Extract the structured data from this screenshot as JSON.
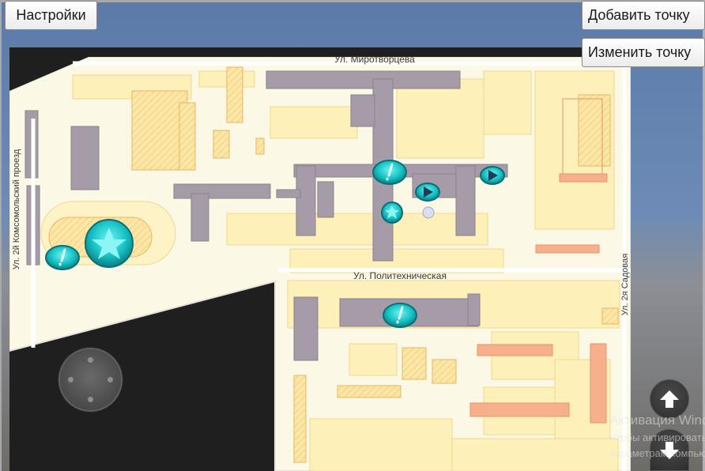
{
  "toolbar": {
    "settings_label": "Настройки",
    "add_point_label": "Добавить точку",
    "edit_point_label": "Изменить точку"
  },
  "map": {
    "street_labels": {
      "mirotvortseva": "Ул. Миротворцева",
      "politekhnicheskaya": "Ул. Политехническая",
      "komsomolsky": "Ул. 2й Комсомольский проезд",
      "sadovaya": "Ул. 2я Садовая"
    },
    "markers": [
      {
        "id": "stadium-star",
        "icon": "star-icon"
      },
      {
        "id": "stadium-info",
        "icon": "exclamation-icon"
      },
      {
        "id": "main-info",
        "icon": "exclamation-icon"
      },
      {
        "id": "main-arrow-1",
        "icon": "arrow-right-icon"
      },
      {
        "id": "main-arrow-2",
        "icon": "arrow-right-icon"
      },
      {
        "id": "main-star",
        "icon": "star-icon"
      },
      {
        "id": "south-info",
        "icon": "exclamation-icon"
      }
    ],
    "colors": {
      "marker": "#14c8c8",
      "building": "#a39aa3",
      "ground": "#fbf7e2",
      "accent": "#f6a57c"
    }
  },
  "controls": {
    "joystick_icon": "joystick-icon",
    "up_icon": "arrow-up-icon",
    "down_icon": "arrow-down-icon"
  },
  "watermark": {
    "title": "Активация Windows",
    "line1": "Чтобы активировать Windows, перейдите к",
    "line2": "параметрам компьютера."
  }
}
